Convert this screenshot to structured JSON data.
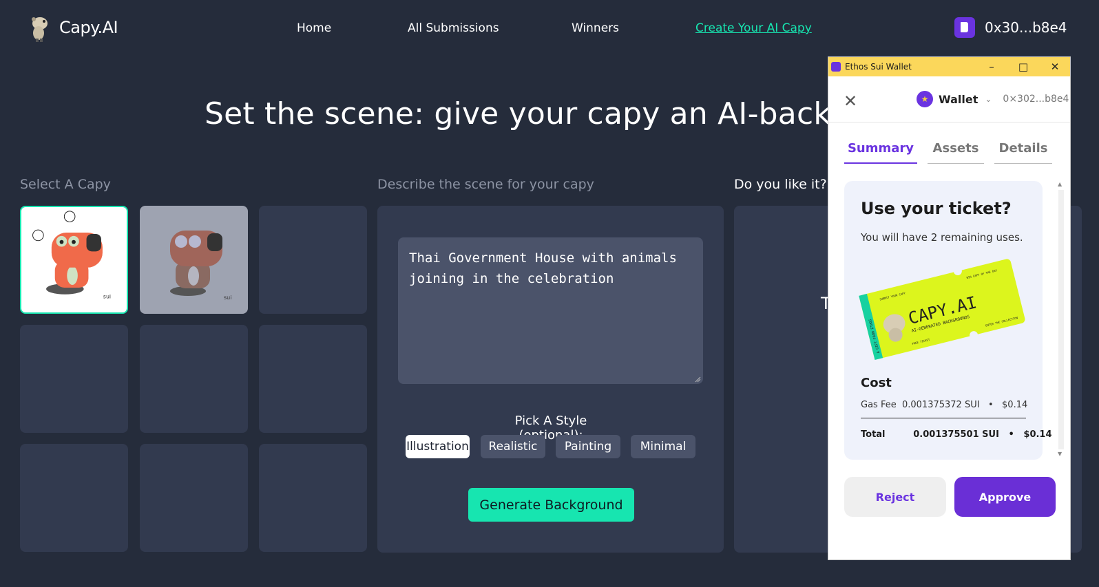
{
  "header": {
    "logo_text": "Capy.AI",
    "nav": [
      "Home",
      "All Submissions",
      "Winners",
      "Create Your AI Capy"
    ],
    "account": "0x30...b8e4"
  },
  "hero": "Set the scene: give your capy an AI-background",
  "labels": {
    "select": "Select A Capy",
    "describe": "Describe the scene for your capy",
    "like": "Do you like it?"
  },
  "prompt": {
    "value": "Thai Government House with animals joining in the celebration",
    "placeholder": "Describe the scene for your capy"
  },
  "style": {
    "label": "Pick A Style (optional):",
    "options": [
      "Illustration",
      "Realistic",
      "Painting",
      "Minimal"
    ],
    "selected": "Illustration"
  },
  "generate_label": "Generate Background",
  "preview_text": "T",
  "tile_watermark": "sui",
  "wallet": {
    "window_title": "Ethos Sui Wallet",
    "name": "Wallet",
    "address": "0×302...b8e4",
    "tabs": [
      "Summary",
      "Assets",
      "Details"
    ],
    "card_title": "Use your ticket?",
    "card_sub": "You will have 2 remaining uses.",
    "ticket": {
      "brand": "CAPY.AI",
      "tagline": "AI-GENERATED BACKGROUNDS",
      "top_left": "SUBMIT YOUR CAPY",
      "top_right": "WIN CAPY OF THE DAY",
      "bottom_left": "FREE TICKET",
      "bottom_right": "ENTER THE COLLECTION",
      "side": "A GIFT FROM ETHOS"
    },
    "cost_label": "Cost",
    "gas_label": "Gas Fee",
    "gas_sui": "0.001375372 SUI",
    "gas_usd": "$0.14",
    "total_label": "Total",
    "total_sui": "0.001375501 SUI",
    "total_usd": "$0.14",
    "reject": "Reject",
    "approve": "Approve"
  },
  "colors": {
    "bg": "#252c3b",
    "accent": "#17e5b0",
    "purple": "#6a33e0",
    "titlebar": "#fbd75b"
  }
}
